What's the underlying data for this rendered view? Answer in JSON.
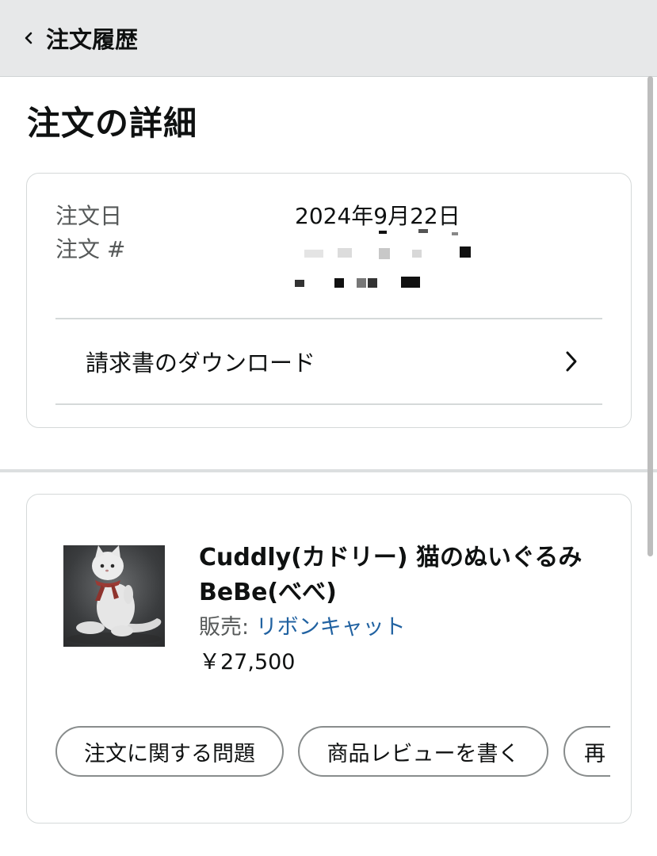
{
  "header": {
    "back_label": "注文履歴"
  },
  "page": {
    "title": "注文の詳細"
  },
  "order": {
    "date_label": "注文日",
    "date_value": "2024年9月22日",
    "number_label": "注文 #",
    "invoice_label": "請求書のダウンロード"
  },
  "product": {
    "title": "Cuddly(カドリー) 猫のぬいぐるみ BeBe(べべ)",
    "seller_prefix": "販売: ",
    "seller_name": "リボンキャット",
    "price": "￥27,500"
  },
  "actions": {
    "problem": "注文に関する問題",
    "review": "商品レビューを書く",
    "rebuy": "再"
  },
  "colors": {
    "header_bg": "#e7e8e9",
    "link": "#2162a1",
    "border": "#d5d9d9"
  },
  "icons": {
    "back": "chevron-left-icon",
    "invoice": "chevron-right-icon"
  }
}
